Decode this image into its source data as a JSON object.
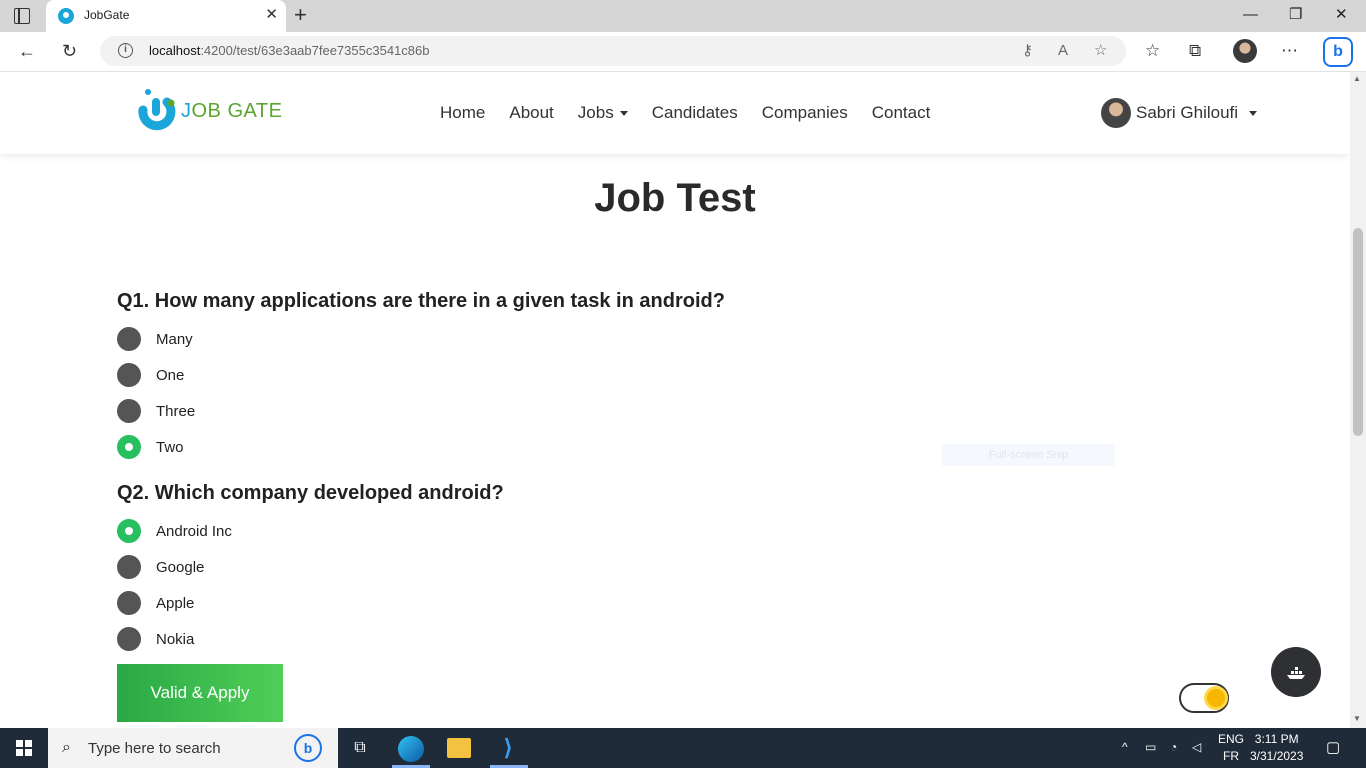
{
  "browser": {
    "tab_title": "JobGate",
    "tab_close": "✕",
    "new_tab": "+",
    "url_host": "localhost",
    "url_path": ":4200/test/63e3aab7fee7355c3541c86b",
    "window_min": "—",
    "window_restore": "❐",
    "window_close": "✕"
  },
  "navbar": {
    "logo_j": "J",
    "logo_rest": "OB GATE",
    "links": [
      "Home",
      "About",
      "Jobs",
      "Candidates",
      "Companies",
      "Contact"
    ],
    "user_name": "Sabri Ghiloufi"
  },
  "test": {
    "title": "Job Test",
    "questions": [
      {
        "text": "Q1. How many applications are there in a given task in android?",
        "options": [
          "Many",
          "One",
          "Three",
          "Two"
        ],
        "selected": "Two"
      },
      {
        "text": "Q2. Which company developed android?",
        "options": [
          "Android Inc",
          "Google",
          "Apple",
          "Nokia"
        ],
        "selected": "Android Inc"
      }
    ],
    "submit_label": "Valid & Apply"
  },
  "overlay": {
    "snip_label": "Full-screen Snip"
  },
  "taskbar": {
    "search_placeholder": "Type here to search",
    "lang_top": "ENG",
    "lang_bottom": "FR",
    "time": "3:11 PM",
    "date": "3/31/2023"
  },
  "colors": {
    "brand_blue": "#1aa6d9",
    "brand_green": "#5aa62f",
    "radio_checked": "#27bf5f",
    "radio_unchecked": "#555555",
    "button_green": "#3dbd52"
  }
}
